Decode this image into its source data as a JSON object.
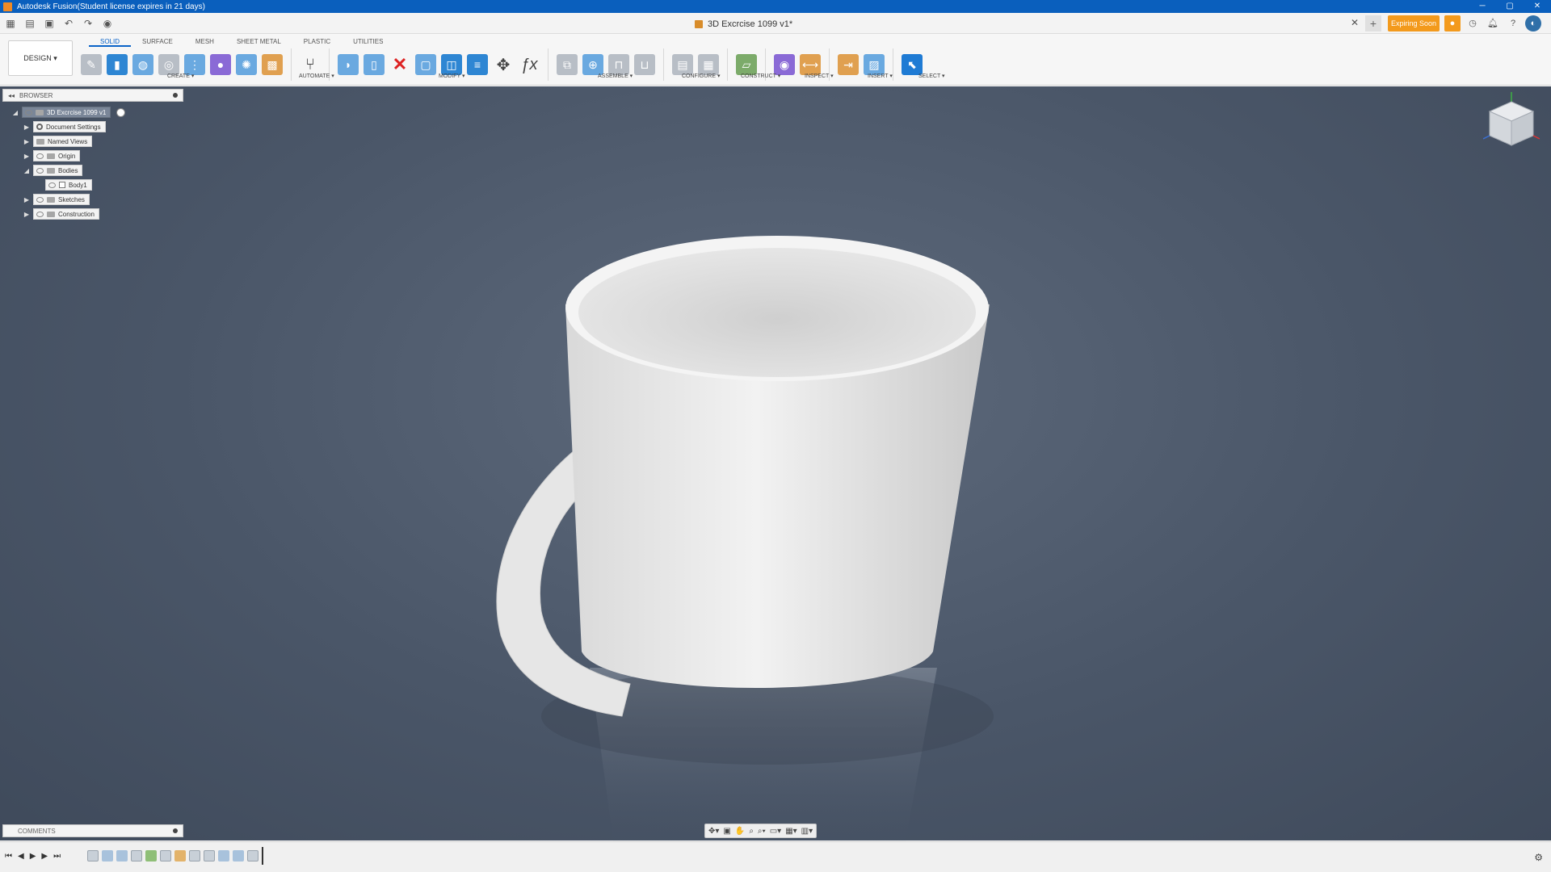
{
  "titlebar": {
    "title": "Autodesk Fusion(Student license expires in 21 days)",
    "min": "─",
    "max": "▢",
    "close": "✕"
  },
  "document": {
    "name": "3D Excrcise 1099 v1*",
    "expiring_label": "Expiring Soon"
  },
  "workspace": {
    "label": "DESIGN ▾"
  },
  "tabs": [
    "SOLID",
    "SURFACE",
    "MESH",
    "SHEET METAL",
    "PLASTIC",
    "UTILITIES"
  ],
  "groups": {
    "create": "CREATE ▾",
    "automate": "AUTOMATE ▾",
    "modify": "MODIFY ▾",
    "assemble": "ASSEMBLE ▾",
    "configure": "CONFIGURE ▾",
    "construct": "CONSTRUCT ▾",
    "inspect": "INSPECT ▾",
    "insert": "INSERT ▾",
    "select": "SELECT ▾"
  },
  "browser": {
    "title": "BROWSER",
    "root": "3D Excrcise 1099 v1",
    "items": [
      "Document Settings",
      "Named Views",
      "Origin",
      "Bodies",
      "Body1",
      "Sketches",
      "Construction"
    ]
  },
  "comments": {
    "title": "COMMENTS"
  },
  "colors": {
    "accent": "#0a63c8",
    "titlebar": "#0a5fbd",
    "viewport": "#4a5668",
    "warning": "#f39a1c"
  },
  "icons": [
    "grid-icon",
    "file-icon",
    "save-icon",
    "undo-icon",
    "redo-icon",
    "extrude-icon",
    "fillet-icon",
    "delete-icon",
    "move-icon",
    "function-icon",
    "select-icon",
    "viewcube-icon",
    "settings-icon"
  ]
}
